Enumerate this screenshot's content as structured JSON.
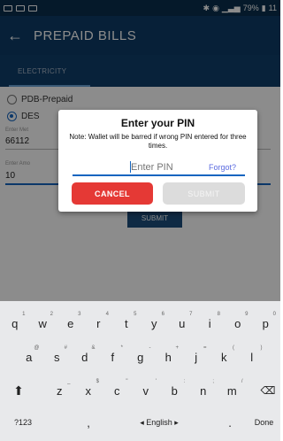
{
  "status_bar": {
    "right_text": "79%",
    "time": "11"
  },
  "app_bar": {
    "title": "PREPAID BILLS"
  },
  "tab": {
    "label": "ELECTRICITY"
  },
  "form": {
    "radio_1": "PDB-Prepaid",
    "radio_2": "DES",
    "meter_label": "Enter Met",
    "meter_value": "66112",
    "amount_label": "Enter Amo",
    "amount_value": "10",
    "submit_label": "SUBMIT"
  },
  "dialog": {
    "title": "Enter your PIN",
    "note": "Note: Wallet will be barred if wrong PIN entered for three times.",
    "pin_placeholder": "Enter PIN",
    "forgot_label": "Forgot?",
    "cancel_label": "CANCEL",
    "submit_label": "SUBMIT"
  },
  "keyboard": {
    "row1": [
      {
        "k": "q",
        "h": "1"
      },
      {
        "k": "w",
        "h": "2"
      },
      {
        "k": "e",
        "h": "3"
      },
      {
        "k": "r",
        "h": "4"
      },
      {
        "k": "t",
        "h": "5"
      },
      {
        "k": "y",
        "h": "6"
      },
      {
        "k": "u",
        "h": "7"
      },
      {
        "k": "i",
        "h": "8"
      },
      {
        "k": "o",
        "h": "9"
      },
      {
        "k": "p",
        "h": "0"
      }
    ],
    "row2": [
      {
        "k": "a",
        "h": "@"
      },
      {
        "k": "s",
        "h": "#"
      },
      {
        "k": "d",
        "h": "&"
      },
      {
        "k": "f",
        "h": "*"
      },
      {
        "k": "g",
        "h": "-"
      },
      {
        "k": "h",
        "h": "+"
      },
      {
        "k": "j",
        "h": "="
      },
      {
        "k": "k",
        "h": "("
      },
      {
        "k": "l",
        "h": ")"
      }
    ],
    "row3": [
      {
        "k": "z",
        "h": "_"
      },
      {
        "k": "x",
        "h": "$"
      },
      {
        "k": "c",
        "h": "\""
      },
      {
        "k": "v",
        "h": "'"
      },
      {
        "k": "b",
        "h": ":"
      },
      {
        "k": "n",
        "h": ";"
      },
      {
        "k": "m",
        "h": "/"
      }
    ],
    "symbols_label": "?123",
    "comma_label": ",",
    "space_label": "◂ English ▸",
    "period_label": ".",
    "done_label": "Done"
  }
}
